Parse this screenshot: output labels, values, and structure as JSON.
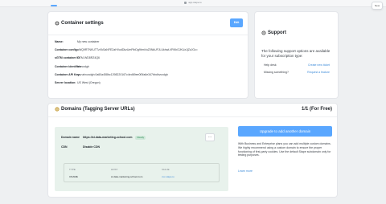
{
  "browser": {
    "url": "app.stape.io",
    "new_label": "New"
  },
  "container": {
    "title": "Container settings",
    "edit_label": "Edit",
    "fields": [
      {
        "label": "Name:",
        "value": "My new container"
      },
      {
        "label": "Container config:",
        "value": "aWQ9RTNKUTTzVkSaNFE2aHVudDkzUmFtbDg9bmVuZ0NkUFJLUkhwLVRKbGJKUzJjZzJGc="
      },
      {
        "label": "sGTM container ID:",
        "value": "GTM-WD8RZ4Q6"
      },
      {
        "label": "Container identifier:",
        "value": "ahvcxdgh"
      },
      {
        "label": "Container API Key:",
        "value": "sav:ahvcxdgh:0a60a458bc1298220167c4ed69ee0f3fa6e347bbdhvcxdgh"
      },
      {
        "label": "Server location:",
        "value": "US West (Oregon)"
      }
    ]
  },
  "support": {
    "title": "Support",
    "description": "The following support options are available for your subscription type:",
    "items": [
      {
        "label": "Help desk",
        "link": "Create new ticket"
      },
      {
        "label": "Missing something?",
        "link": "Request a feature"
      }
    ]
  },
  "domains": {
    "title": "Domains (Tagging Server URLs)",
    "count": "1/1 (For Free)",
    "domain_label": "Domain name",
    "domain_value": "https://st.data-marketing-school.com",
    "status": "Ready",
    "cdn_label": "CDN",
    "cdn_value": "Disable CDN",
    "dns": {
      "headers": [
        "TYPE",
        "HOST",
        "VALUE"
      ],
      "row": [
        "CNAME",
        "st.data-marketing-school.com",
        "xxx.stape.io"
      ]
    },
    "upgrade_label": "Upgrade to add another domain",
    "upgrade_text": "With Business and Enterprise plans you can add multiple custom domains. We highly recommend using a custom domain to ensure the proper functioning of first-party cookies. Use the default Stape subdomain only for testing purposes.",
    "learn_more": "Learn more"
  }
}
